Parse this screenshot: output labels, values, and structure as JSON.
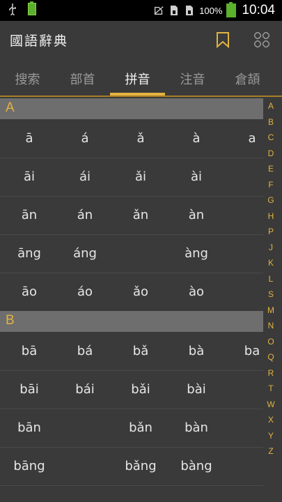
{
  "status_bar": {
    "usb_icon": "usb-icon",
    "battery_small_label": "100%",
    "icons": [
      "no-sim-icon",
      "sim-card-1-icon",
      "sim-card-2-icon"
    ],
    "battery_percent": "100%",
    "time": "10:04",
    "accent_battery": "#5bb02e"
  },
  "app_bar": {
    "title": "國語辭典",
    "bookmark_icon": "bookmark-icon",
    "menu_icon": "grid-menu-icon"
  },
  "tabs": [
    {
      "label": "搜索"
    },
    {
      "label": "部首"
    },
    {
      "label": "拼音",
      "active": true
    },
    {
      "label": "注音"
    },
    {
      "label": "倉頡"
    }
  ],
  "sections": [
    {
      "letter": "A",
      "rows": [
        [
          "ā",
          "á",
          "ǎ",
          "à",
          "a"
        ],
        [
          "āi",
          "ái",
          "ǎi",
          "ài",
          ""
        ],
        [
          "ān",
          "án",
          "ǎn",
          "àn",
          ""
        ],
        [
          "āng",
          "áng",
          "",
          "àng",
          ""
        ],
        [
          "āo",
          "áo",
          "ǎo",
          "ào",
          ""
        ]
      ]
    },
    {
      "letter": "B",
      "rows": [
        [
          "bā",
          "bá",
          "bǎ",
          "bà",
          "ba"
        ],
        [
          "bāi",
          "bái",
          "bǎi",
          "bài",
          ""
        ],
        [
          "bān",
          "",
          "bǎn",
          "bàn",
          ""
        ],
        [
          "bāng",
          "",
          "bǎng",
          "bàng",
          ""
        ]
      ]
    }
  ],
  "index_letters": [
    "A",
    "B",
    "C",
    "D",
    "E",
    "F",
    "G",
    "H",
    "P",
    "J",
    "K",
    "L",
    "S",
    "M",
    "N",
    "O",
    "Q",
    "R",
    "T",
    "W",
    "X",
    "Y",
    "Z"
  ],
  "colors": {
    "accent": "#e2b340",
    "background": "#3a3a3a",
    "section_header": "#6e6e6e"
  }
}
